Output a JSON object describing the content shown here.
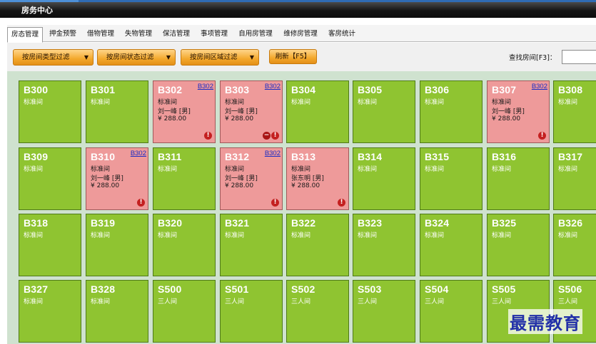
{
  "window": {
    "title": "房务中心"
  },
  "tabs": [
    {
      "label": "房态管理",
      "active": true
    },
    {
      "label": "押金预警",
      "active": false
    },
    {
      "label": "借物管理",
      "active": false
    },
    {
      "label": "失物管理",
      "active": false
    },
    {
      "label": "保洁管理",
      "active": false
    },
    {
      "label": "事项管理",
      "active": false
    },
    {
      "label": "自用房管理",
      "active": false
    },
    {
      "label": "维修房管理",
      "active": false
    },
    {
      "label": "客房统计",
      "active": false
    }
  ],
  "toolbar": {
    "filter_type": "按房间类型过滤",
    "filter_status": "按房间状态过滤",
    "filter_area": "按房间区域过滤",
    "refresh": "刷新【F5】",
    "search_label": "查找房间[F3]：",
    "search_value": ""
  },
  "colors": {
    "vacant": "#8fc431",
    "occupied": "#ee9a9a",
    "link": "#1a2cc4"
  },
  "rooms": [
    [
      {
        "number": "B300",
        "type": "标准间",
        "status": "vacant"
      },
      {
        "number": "B301",
        "type": "标准间",
        "status": "vacant"
      },
      {
        "number": "B302",
        "type": "标准间",
        "status": "occupied",
        "guest": "刘一峰 [男]",
        "price": "¥ 288.00",
        "link": "B302",
        "icons": [
          "alert"
        ]
      },
      {
        "number": "B303",
        "type": "标准间",
        "status": "occupied",
        "guest": "刘一峰 [男]",
        "price": "¥ 288.00",
        "link": "B302",
        "icons": [
          "minus",
          "alert"
        ]
      },
      {
        "number": "B304",
        "type": "标准间",
        "status": "vacant"
      },
      {
        "number": "B305",
        "type": "标准间",
        "status": "vacant"
      },
      {
        "number": "B306",
        "type": "标准间",
        "status": "vacant"
      },
      {
        "number": "B307",
        "type": "标准间",
        "status": "occupied",
        "guest": "刘一峰 [男]",
        "price": "¥ 288.00",
        "link": "B302",
        "icons": [
          "alert"
        ]
      },
      {
        "number": "B308",
        "type": "标准间",
        "status": "vacant"
      }
    ],
    [
      {
        "number": "B309",
        "type": "标准间",
        "status": "vacant"
      },
      {
        "number": "B310",
        "type": "标准间",
        "status": "occupied",
        "guest": "刘一峰 [男]",
        "price": "¥ 288.00",
        "link": "B302",
        "icons": [
          "alert"
        ]
      },
      {
        "number": "B311",
        "type": "标准间",
        "status": "vacant"
      },
      {
        "number": "B312",
        "type": "标准间",
        "status": "occupied",
        "guest": "刘一峰 [男]",
        "price": "¥ 288.00",
        "link": "B302",
        "icons": [
          "alert"
        ]
      },
      {
        "number": "B313",
        "type": "标准间",
        "status": "occupied",
        "guest": "张东明 [男]",
        "price": "¥ 288.00",
        "icons": [
          "alert"
        ]
      },
      {
        "number": "B314",
        "type": "标准间",
        "status": "vacant"
      },
      {
        "number": "B315",
        "type": "标准间",
        "status": "vacant"
      },
      {
        "number": "B316",
        "type": "标准间",
        "status": "vacant"
      },
      {
        "number": "B317",
        "type": "标准间",
        "status": "vacant"
      }
    ],
    [
      {
        "number": "B318",
        "type": "标准间",
        "status": "vacant"
      },
      {
        "number": "B319",
        "type": "标准间",
        "status": "vacant"
      },
      {
        "number": "B320",
        "type": "标准间",
        "status": "vacant"
      },
      {
        "number": "B321",
        "type": "标准间",
        "status": "vacant"
      },
      {
        "number": "B322",
        "type": "标准间",
        "status": "vacant"
      },
      {
        "number": "B323",
        "type": "标准间",
        "status": "vacant"
      },
      {
        "number": "B324",
        "type": "标准间",
        "status": "vacant"
      },
      {
        "number": "B325",
        "type": "标准间",
        "status": "vacant"
      },
      {
        "number": "B326",
        "type": "标准间",
        "status": "vacant"
      }
    ],
    [
      {
        "number": "B327",
        "type": "标准间",
        "status": "vacant"
      },
      {
        "number": "B328",
        "type": "标准间",
        "status": "vacant"
      },
      {
        "number": "S500",
        "type": "三人间",
        "status": "vacant"
      },
      {
        "number": "S501",
        "type": "三人间",
        "status": "vacant"
      },
      {
        "number": "S502",
        "type": "三人间",
        "status": "vacant"
      },
      {
        "number": "S503",
        "type": "三人间",
        "status": "vacant"
      },
      {
        "number": "S504",
        "type": "三人间",
        "status": "vacant"
      },
      {
        "number": "S505",
        "type": "三人间",
        "status": "vacant"
      },
      {
        "number": "S506",
        "type": "三人间",
        "status": "vacant"
      }
    ]
  ],
  "watermark": "最需教育"
}
